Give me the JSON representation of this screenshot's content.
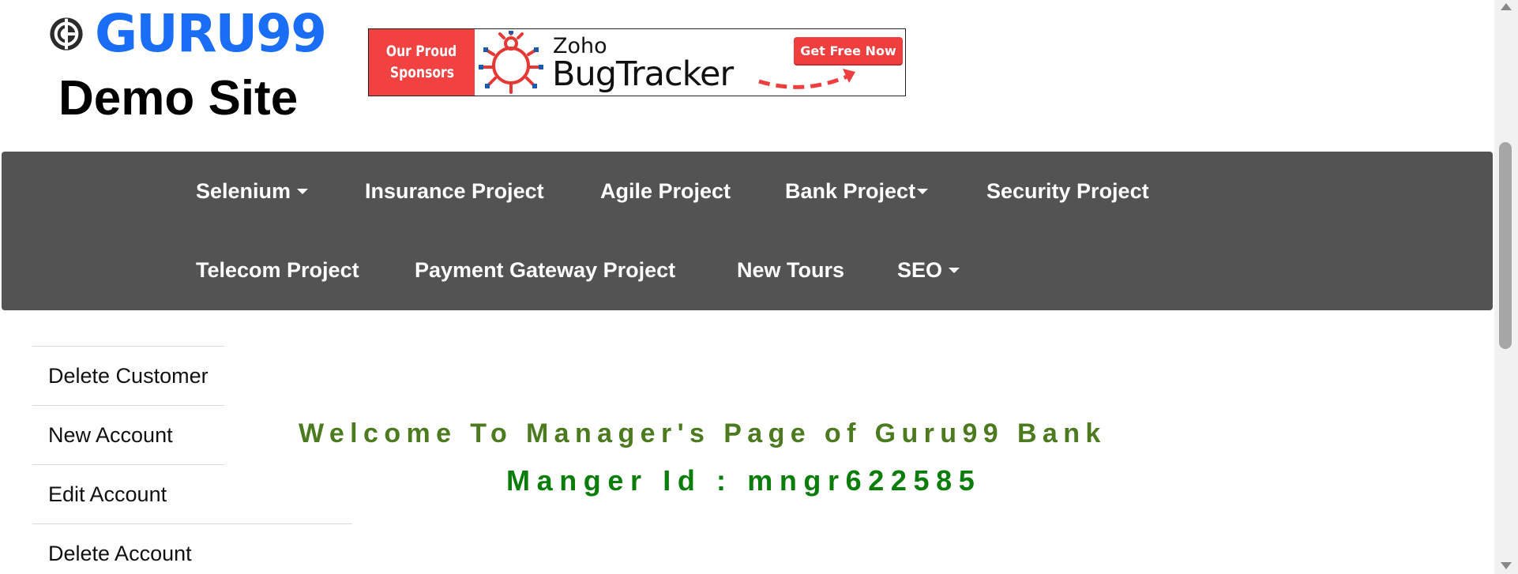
{
  "logo": {
    "wordmark": "GURU99",
    "subtitle": "Demo Site"
  },
  "sponsor_banner": {
    "left_label_line1": "Our Proud",
    "left_label_line2": "Sponsors",
    "brand_small": "Zoho",
    "brand_large": "BugTracker",
    "cta_label": "Get Free Now"
  },
  "nav": {
    "row1": [
      {
        "label": "Selenium",
        "dropdown": true
      },
      {
        "label": "Insurance Project",
        "dropdown": false
      },
      {
        "label": "Agile Project",
        "dropdown": false
      },
      {
        "label": "Bank Project",
        "dropdown": true
      },
      {
        "label": "Security Project",
        "dropdown": false
      }
    ],
    "row2": [
      {
        "label": "Telecom Project",
        "dropdown": false
      },
      {
        "label": "Payment Gateway Project",
        "dropdown": false
      },
      {
        "label": "New Tours",
        "dropdown": false
      },
      {
        "label": "SEO",
        "dropdown": true
      }
    ]
  },
  "sidebar": {
    "items": [
      {
        "label": "Delete Customer"
      },
      {
        "label": "New Account"
      },
      {
        "label": "Edit Account"
      },
      {
        "label": "Delete Account"
      }
    ]
  },
  "main": {
    "welcome": "Welcome To Manager's Page of Guru99 Bank",
    "manager_id": "Manger Id : mngr622585"
  },
  "colors": {
    "logo_blue": "#1a6ef5",
    "nav_background": "#535353",
    "banner_red": "#f24141",
    "welcome_green": "#4b7a1f",
    "manager_id_green": "#0a7d0a"
  }
}
